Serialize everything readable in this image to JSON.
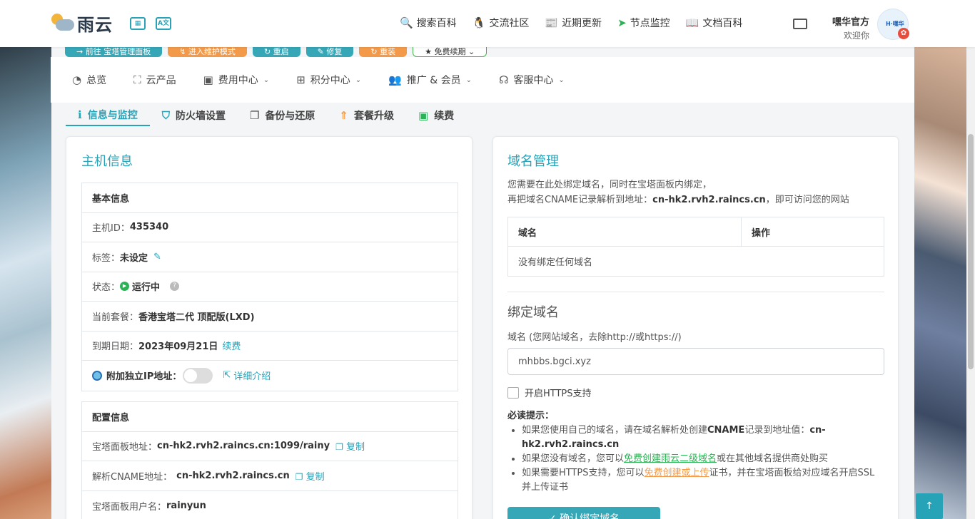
{
  "brand": {
    "name": "雨云"
  },
  "top_nav": [
    {
      "icon": "search-icon",
      "glyph": "🔍",
      "label": "搜索百科"
    },
    {
      "icon": "qq-icon",
      "glyph": "🐧",
      "label": "交流社区"
    },
    {
      "icon": "news-icon",
      "glyph": "📰",
      "label": "近期更新"
    },
    {
      "icon": "send-icon",
      "glyph": "➤",
      "label": "节点监控"
    },
    {
      "icon": "book-icon",
      "glyph": "📖",
      "label": "文档百科"
    }
  ],
  "user": {
    "name": "嘿华官方",
    "welcome": "欢迎你",
    "avatar_text": "H·嘿华"
  },
  "peek_buttons": [
    "→ 前往 宝塔管理面板",
    "↯ 进入维护模式",
    "↻ 重启",
    "✎ 修复",
    "↻ 重装",
    "★ 免费续期 ⌄"
  ],
  "main_nav": [
    {
      "icon": "dashboard-icon",
      "glyph": "◔",
      "label": "总览",
      "dropdown": false
    },
    {
      "icon": "cubes-icon",
      "glyph": "⛶",
      "label": "云产品",
      "dropdown": false
    },
    {
      "icon": "money-icon",
      "glyph": "▣",
      "label": "费用中心",
      "dropdown": true
    },
    {
      "icon": "gift-icon",
      "glyph": "⊞",
      "label": "积分中心",
      "dropdown": true
    },
    {
      "icon": "users-icon",
      "glyph": "👥",
      "label": "推广 & 会员",
      "dropdown": true
    },
    {
      "icon": "headset-icon",
      "glyph": "☊",
      "label": "客服中心",
      "dropdown": true
    }
  ],
  "tabs": [
    {
      "icon": "info-icon",
      "glyph": "ℹ",
      "label": "信息与监控",
      "active": true,
      "color": "#27a3b8"
    },
    {
      "icon": "shield-icon",
      "glyph": "⛉",
      "label": "防火墙设置",
      "active": false,
      "color": "#27a3b8"
    },
    {
      "icon": "copy-icon",
      "glyph": "❐",
      "label": "备份与还原",
      "active": false,
      "color": "#555"
    },
    {
      "icon": "upgrade-icon",
      "glyph": "⇑",
      "label": "套餐升级",
      "active": false,
      "color": "#f29a4a"
    },
    {
      "icon": "money-icon",
      "glyph": "▣",
      "label": "续费",
      "active": false,
      "color": "#2ab354"
    }
  ],
  "host_info": {
    "title": "主机信息",
    "basic": {
      "header": "基本信息",
      "id_label": "主机ID：",
      "id_value": "435340",
      "tag_label": "标签：",
      "tag_value": "未设定",
      "status_label": "状态：",
      "status_value": "运行中",
      "plan_label": "当前套餐：",
      "plan_value": "香港宝塔二代 顶配版(LXD)",
      "expire_label": "到期日期：",
      "expire_value": "2023年09月21日",
      "renew_link": "续费",
      "ip_label": "附加独立IP地址：",
      "ip_toggle_on": false,
      "ip_detail_link": "详细介绍"
    },
    "config": {
      "header": "配置信息",
      "panel_label": "宝塔面板地址：",
      "panel_value": "cn-hk2.rvh2.raincs.cn:1099/rainy",
      "cname_label": "解析CNAME地址：",
      "cname_value": "cn-hk2.rvh2.raincs.cn",
      "user_label": "宝塔面板用户名：",
      "user_value": "rainyun",
      "copy_label": "复制"
    }
  },
  "domain": {
    "title": "域名管理",
    "note_line1": "您需要在此处绑定域名，同时在宝塔面板内绑定，",
    "note_line2_prefix": "再把域名CNAME记录解析到地址：",
    "note_line2_addr": "cn-hk2.rvh2.raincs.cn",
    "note_line2_suffix": "，即可访问您的网站",
    "table_headers": [
      "域名",
      "操作"
    ],
    "empty_text": "没有绑定任何域名",
    "bind_title": "绑定域名",
    "field_label": "域名 (您网站域名，去除http://或https://)",
    "field_value": "mhbbs.bgci.xyz",
    "https_label": "开启HTTPS支持",
    "https_checked": false,
    "tips_title": "必读提示：",
    "tip1_prefix": "如果您使用自己的域名，请在域名解析处创建",
    "tip1_cname": "CNAME",
    "tip1_mid": "记录到地址值：",
    "tip1_addr": "cn-hk2.rvh2.raincs.cn",
    "tip2_prefix": "如果您没有域名，您可以",
    "tip2_link": "免费创建雨云二级域名",
    "tip2_suffix": "或在其他域名提供商处购买",
    "tip3_prefix": "如果需要HTTPS支持，您可以",
    "tip3_link": "免费创建或上传",
    "tip3_suffix": "证书，并在宝塔面板给对应域名开启SSL并上传证书",
    "confirm_label": "✓ 确认绑定域名"
  },
  "back_to_top": "↑",
  "colors": {
    "accent": "#27a3b8",
    "green": "#2ab354",
    "orange": "#f29a4a"
  }
}
